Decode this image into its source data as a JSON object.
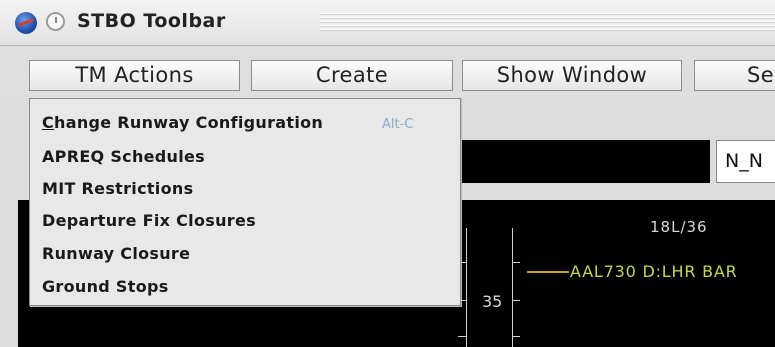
{
  "window": {
    "title": "STBO Toolbar",
    "logo": "nasa-logo-icon",
    "clock_icon": "clock-icon"
  },
  "toolbar": {
    "buttons": [
      "TM Actions",
      "Create",
      "Show Window",
      "Se"
    ]
  },
  "menu": {
    "items": [
      {
        "mnemonic": "C",
        "rest": "hange Runway Configuration",
        "shortcut": "Alt-C"
      },
      {
        "label": "APREQ Schedules"
      },
      {
        "label": "MIT Restrictions"
      },
      {
        "label": "Departure Fix Closures"
      },
      {
        "label": "Runway Closure"
      },
      {
        "label": "Ground Stops"
      }
    ]
  },
  "panel": {
    "selector_value": "N_N",
    "runway_label": "18L/36",
    "flight_label": "AAL730 D:LHR BAR",
    "tick_label": "35"
  },
  "colors": {
    "display_bg": "#000000",
    "flight_text": "#c4d656",
    "shortcut_text": "#8fa8c8"
  }
}
